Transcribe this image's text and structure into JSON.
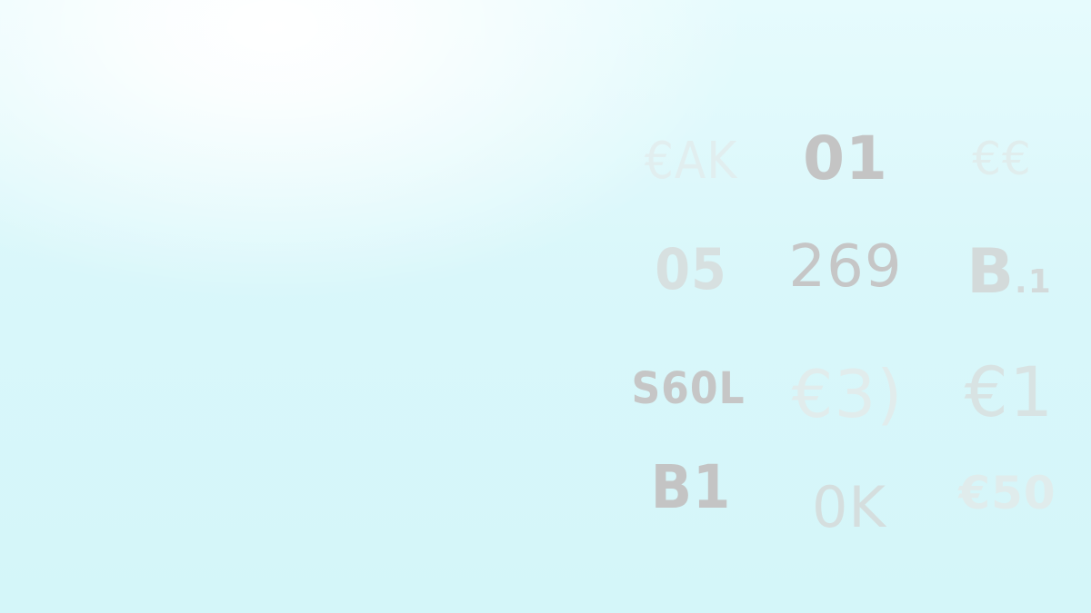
{
  "background": {
    "top_color": "#ffffff",
    "base_color": "#d6f7fa"
  },
  "glyphs": {
    "row1": [
      "€AK",
      "01",
      "€€"
    ],
    "row2": [
      "05",
      "269",
      "B",
      ".1"
    ],
    "row3": [
      "S60L",
      "€3)",
      "€1"
    ],
    "row4": [
      "B1",
      "0K",
      "€50"
    ]
  }
}
